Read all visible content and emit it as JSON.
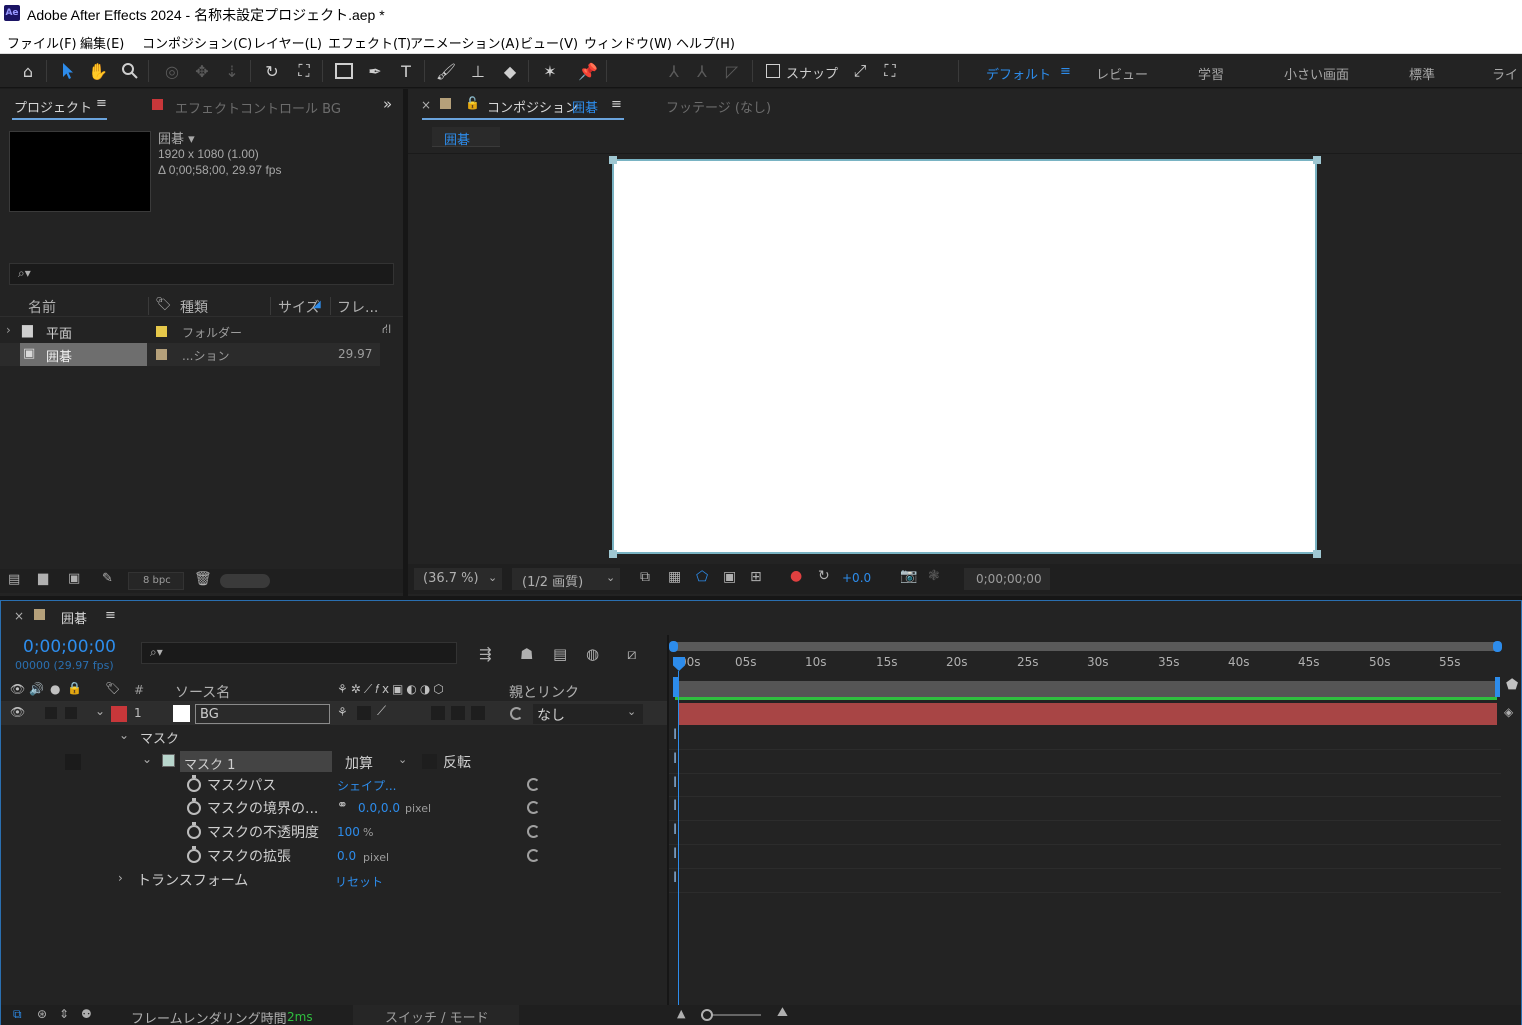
{
  "window": {
    "title": "Adobe After Effects 2024 - 名称未設定プロジェクト.aep *",
    "logo": "Ae"
  },
  "menu": [
    "ファイル(F)",
    "編集(E)",
    "コンポジション(C)",
    "レイヤー(L)",
    "エフェクト(T)",
    "アニメーション(A)",
    "ビュー(V)",
    "ウィンドウ(W)",
    "ヘルプ(H)"
  ],
  "toolbar": {
    "snap_label": "スナップ",
    "workspaces": [
      "デフォルト",
      "レビュー",
      "学習",
      "小さい画面",
      "標準",
      "ライ"
    ]
  },
  "project": {
    "tab": "プロジェクト",
    "effect_tab": "エフェクトコントロール BG",
    "selected_name": "囲碁 ▾",
    "resolution": "1920 x 1080 (1.00)",
    "duration": "Δ 0;00;58;00, 29.97 fps",
    "columns": {
      "name": "名前",
      "type": "種類",
      "size": "サイズ",
      "fps": "フレ..."
    },
    "items": [
      {
        "name": "平面",
        "type": "フォルダー",
        "fps": "",
        "color": "#e6c84a"
      },
      {
        "name": "囲碁",
        "type": "...ション",
        "fps": "29.97",
        "color": "#b5a07a"
      }
    ],
    "bpc": "8 bpc"
  },
  "composition": {
    "tab_prefix": "コンポジション",
    "tab_name": "囲碁",
    "footage_tab": "フッテージ (なし)",
    "breadcrumb": "囲碁",
    "zoom": "(36.7 %)",
    "quality": "(1/2 画質)",
    "exposure": "+0.0",
    "timecode": "0;00;00;00"
  },
  "timeline": {
    "tab": "囲碁",
    "timecode": "0;00;00;00",
    "frames": "00000 (29.97 fps)",
    "col_source": "ソース名",
    "col_parent": "親とリンク",
    "col_hash": "#",
    "layer": {
      "index": "1",
      "name": "BG",
      "parent": "なし",
      "color": "#c8373a"
    },
    "mask_group": "マスク",
    "mask": {
      "name": "マスク 1",
      "mode": "加算",
      "invert": "反転"
    },
    "props": [
      {
        "label": "マスクパス",
        "value": "シェイプ...",
        "unit": ""
      },
      {
        "label": "マスクの境界の...",
        "value": "0.0,0.0",
        "unit": "pixel"
      },
      {
        "label": "マスクの不透明度",
        "value": "100",
        "unit": "%"
      },
      {
        "label": "マスクの拡張",
        "value": "0.0",
        "unit": "pixel"
      }
    ],
    "transform": "トランスフォーム",
    "reset": "リセット",
    "ruler": [
      "00s",
      "05s",
      "10s",
      "15s",
      "20s",
      "25s",
      "30s",
      "35s",
      "40s",
      "45s",
      "50s",
      "55s"
    ],
    "render_time_label": "フレームレンダリング時間",
    "render_time": "2ms",
    "switch_mode": "スイッチ / モード"
  }
}
